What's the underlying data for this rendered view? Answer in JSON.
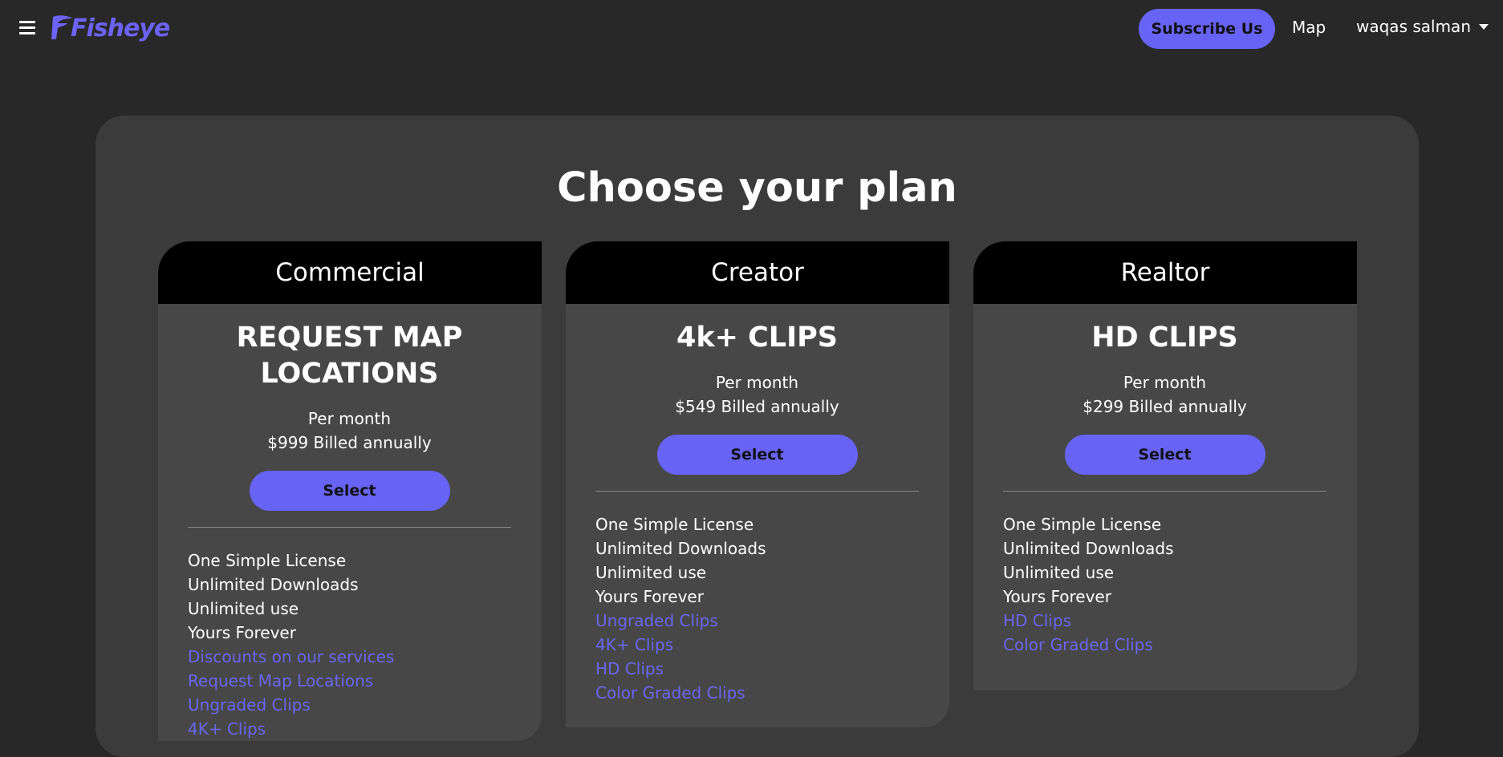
{
  "navbar": {
    "logo_text": "Fisheye",
    "subscribe_label": "Subscribe Us",
    "map_label": "Map",
    "user_name": "waqas salman"
  },
  "page": {
    "title": "Choose your plan"
  },
  "colors": {
    "accent": "#6663f5",
    "background": "#282828",
    "panel": "#3b3b3b",
    "card": "#474747",
    "card_header": "#000000"
  },
  "plans": [
    {
      "name": "Commercial",
      "tier": "REQUEST MAP LOCATIONS",
      "per_month": "Per month",
      "price": "$999 Billed annually",
      "select_label": "Select",
      "features": [
        "One Simple License",
        "Unlimited Downloads",
        "Unlimited use",
        "Yours Forever"
      ],
      "feature_links": [
        "Discounts on our services",
        "Request Map Locations",
        "Ungraded Clips",
        "4K+ Clips"
      ]
    },
    {
      "name": "Creator",
      "tier": "4k+ CLIPS",
      "per_month": "Per month",
      "price": "$549 Billed annually",
      "select_label": "Select",
      "features": [
        "One Simple License",
        "Unlimited Downloads",
        "Unlimited use",
        "Yours Forever"
      ],
      "feature_links": [
        "Ungraded Clips",
        "4K+ Clips",
        "HD Clips",
        "Color Graded Clips"
      ]
    },
    {
      "name": "Realtor",
      "tier": "HD CLIPS",
      "per_month": "Per month",
      "price": "$299 Billed annually",
      "select_label": "Select",
      "features": [
        "One Simple License",
        "Unlimited Downloads",
        "Unlimited use",
        "Yours Forever"
      ],
      "feature_links": [
        "HD Clips",
        "Color Graded Clips"
      ]
    }
  ]
}
